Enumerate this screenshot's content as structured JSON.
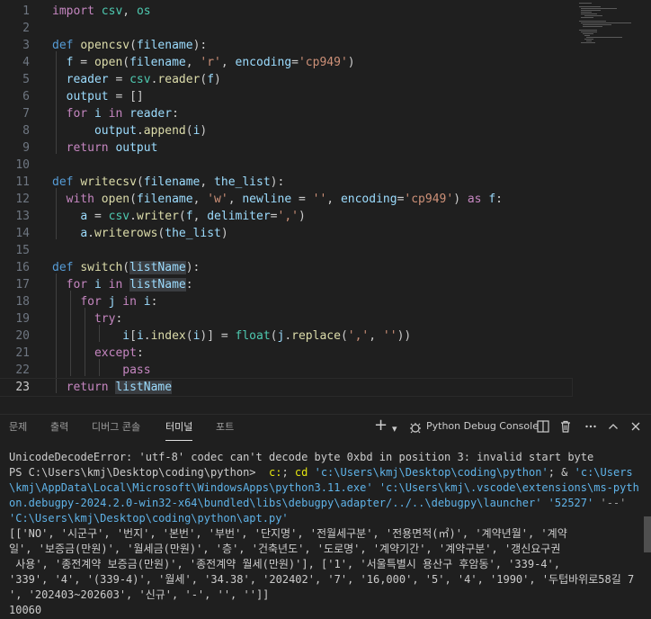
{
  "editor": {
    "lines": [
      {
        "n": "1",
        "text": "import csv, os"
      },
      {
        "n": "2",
        "text": ""
      },
      {
        "n": "3",
        "text": "def opencsv(filename):"
      },
      {
        "n": "4",
        "text": "  f = open(filename, 'r', encoding='cp949')"
      },
      {
        "n": "5",
        "text": "  reader = csv.reader(f)"
      },
      {
        "n": "6",
        "text": "  output = []"
      },
      {
        "n": "7",
        "text": "  for i in reader:"
      },
      {
        "n": "8",
        "text": "      output.append(i)"
      },
      {
        "n": "9",
        "text": "  return output"
      },
      {
        "n": "10",
        "text": ""
      },
      {
        "n": "11",
        "text": "def writecsv(filename, the_list):"
      },
      {
        "n": "12",
        "text": "  with open(filename, 'w', newline = '', encoding='cp949') as f:"
      },
      {
        "n": "13",
        "text": "    a = csv.writer(f, delimiter=',')"
      },
      {
        "n": "14",
        "text": "    a.writerows(the_list)"
      },
      {
        "n": "15",
        "text": ""
      },
      {
        "n": "16",
        "text": "def switch(listName):"
      },
      {
        "n": "17",
        "text": "  for i in listName:"
      },
      {
        "n": "18",
        "text": "    for j in i:"
      },
      {
        "n": "19",
        "text": "      try:"
      },
      {
        "n": "20",
        "text": "          i[i.index(i)] = float(j.replace(',', ''))"
      },
      {
        "n": "21",
        "text": "      except:"
      },
      {
        "n": "22",
        "text": "          pass"
      },
      {
        "n": "23",
        "text": "  return listName"
      }
    ]
  },
  "panel": {
    "tabs": [
      "문제",
      "출력",
      "디버그 콘솔",
      "터미널",
      "포트"
    ],
    "active_tab": "터미널",
    "add_icon": "+",
    "dropdown_icon": "▾",
    "terminal_name": "Python Debug Console",
    "icons": [
      "plus-icon",
      "chevron-down-icon",
      "debug-bug-icon",
      "split-icon",
      "trash-icon",
      "more-icon",
      "chevron-up-icon",
      "close-icon"
    ]
  },
  "terminal": {
    "line1": "UnicodeDecodeError: 'utf-8' codec can't decode byte 0xbd in position 3: invalid start byte",
    "prompt": "PS C:\\Users\\kmj\\Desktop\\coding\\python>",
    "cmd1": "c:",
    "semicolon": ";",
    "cmd2": "cd",
    "arg1": "'c:\\Users\\kmj\\Desktop\\coding\\python'",
    "amp": "; &",
    "arg2": "'c:\\Users\\kmj\\AppData\\Local\\Microsoft\\WindowsApps\\python3.11.exe'",
    "arg3": "'c:\\Users\\kmj\\.vscode\\extensions\\ms-python.debugpy-2024.2.0-win32-x64\\bundled\\libs\\debugpy\\adapter/../..\\debugpy\\launcher'",
    "arg4": "'52527'",
    "arg5": "'--'",
    "arg6": "'C:\\Users\\kmj\\Desktop\\coding\\python\\apt.py'",
    "output_lines": [
      "[['NO', '시군구', '번지', '본번', '부번', '단지명', '전월세구분', '전용면적(㎡)', '계약년월', '계약",
      "일', '보증금(만원)', '월세금(만원)', '층', '건축년도', '도로명', '계약기간', '계약구분', '갱신요구권",
      " 사용', '종전계약 보증금(만원)', '종전계약 월세(만원)'], ['1', '서울특별시 용산구 후암동', '339-4',",
      "'339', '4', '(339-4)', '월세', '34.38', '202402', '7', '16,000', '5', '4', '1990', '두텁바위로58길 7",
      "', '202403~202603', '신규', '-', '', '']]",
      "10060"
    ]
  },
  "colors": {
    "background": "#1f1f1f",
    "keyword": "#c586c0",
    "def": "#569cd6",
    "function": "#dcdcaa",
    "variable": "#9cdcfe",
    "string": "#ce9178",
    "module": "#4ec9b0",
    "terminal_command": "#e5e510",
    "terminal_string": "#5fb3e8"
  }
}
